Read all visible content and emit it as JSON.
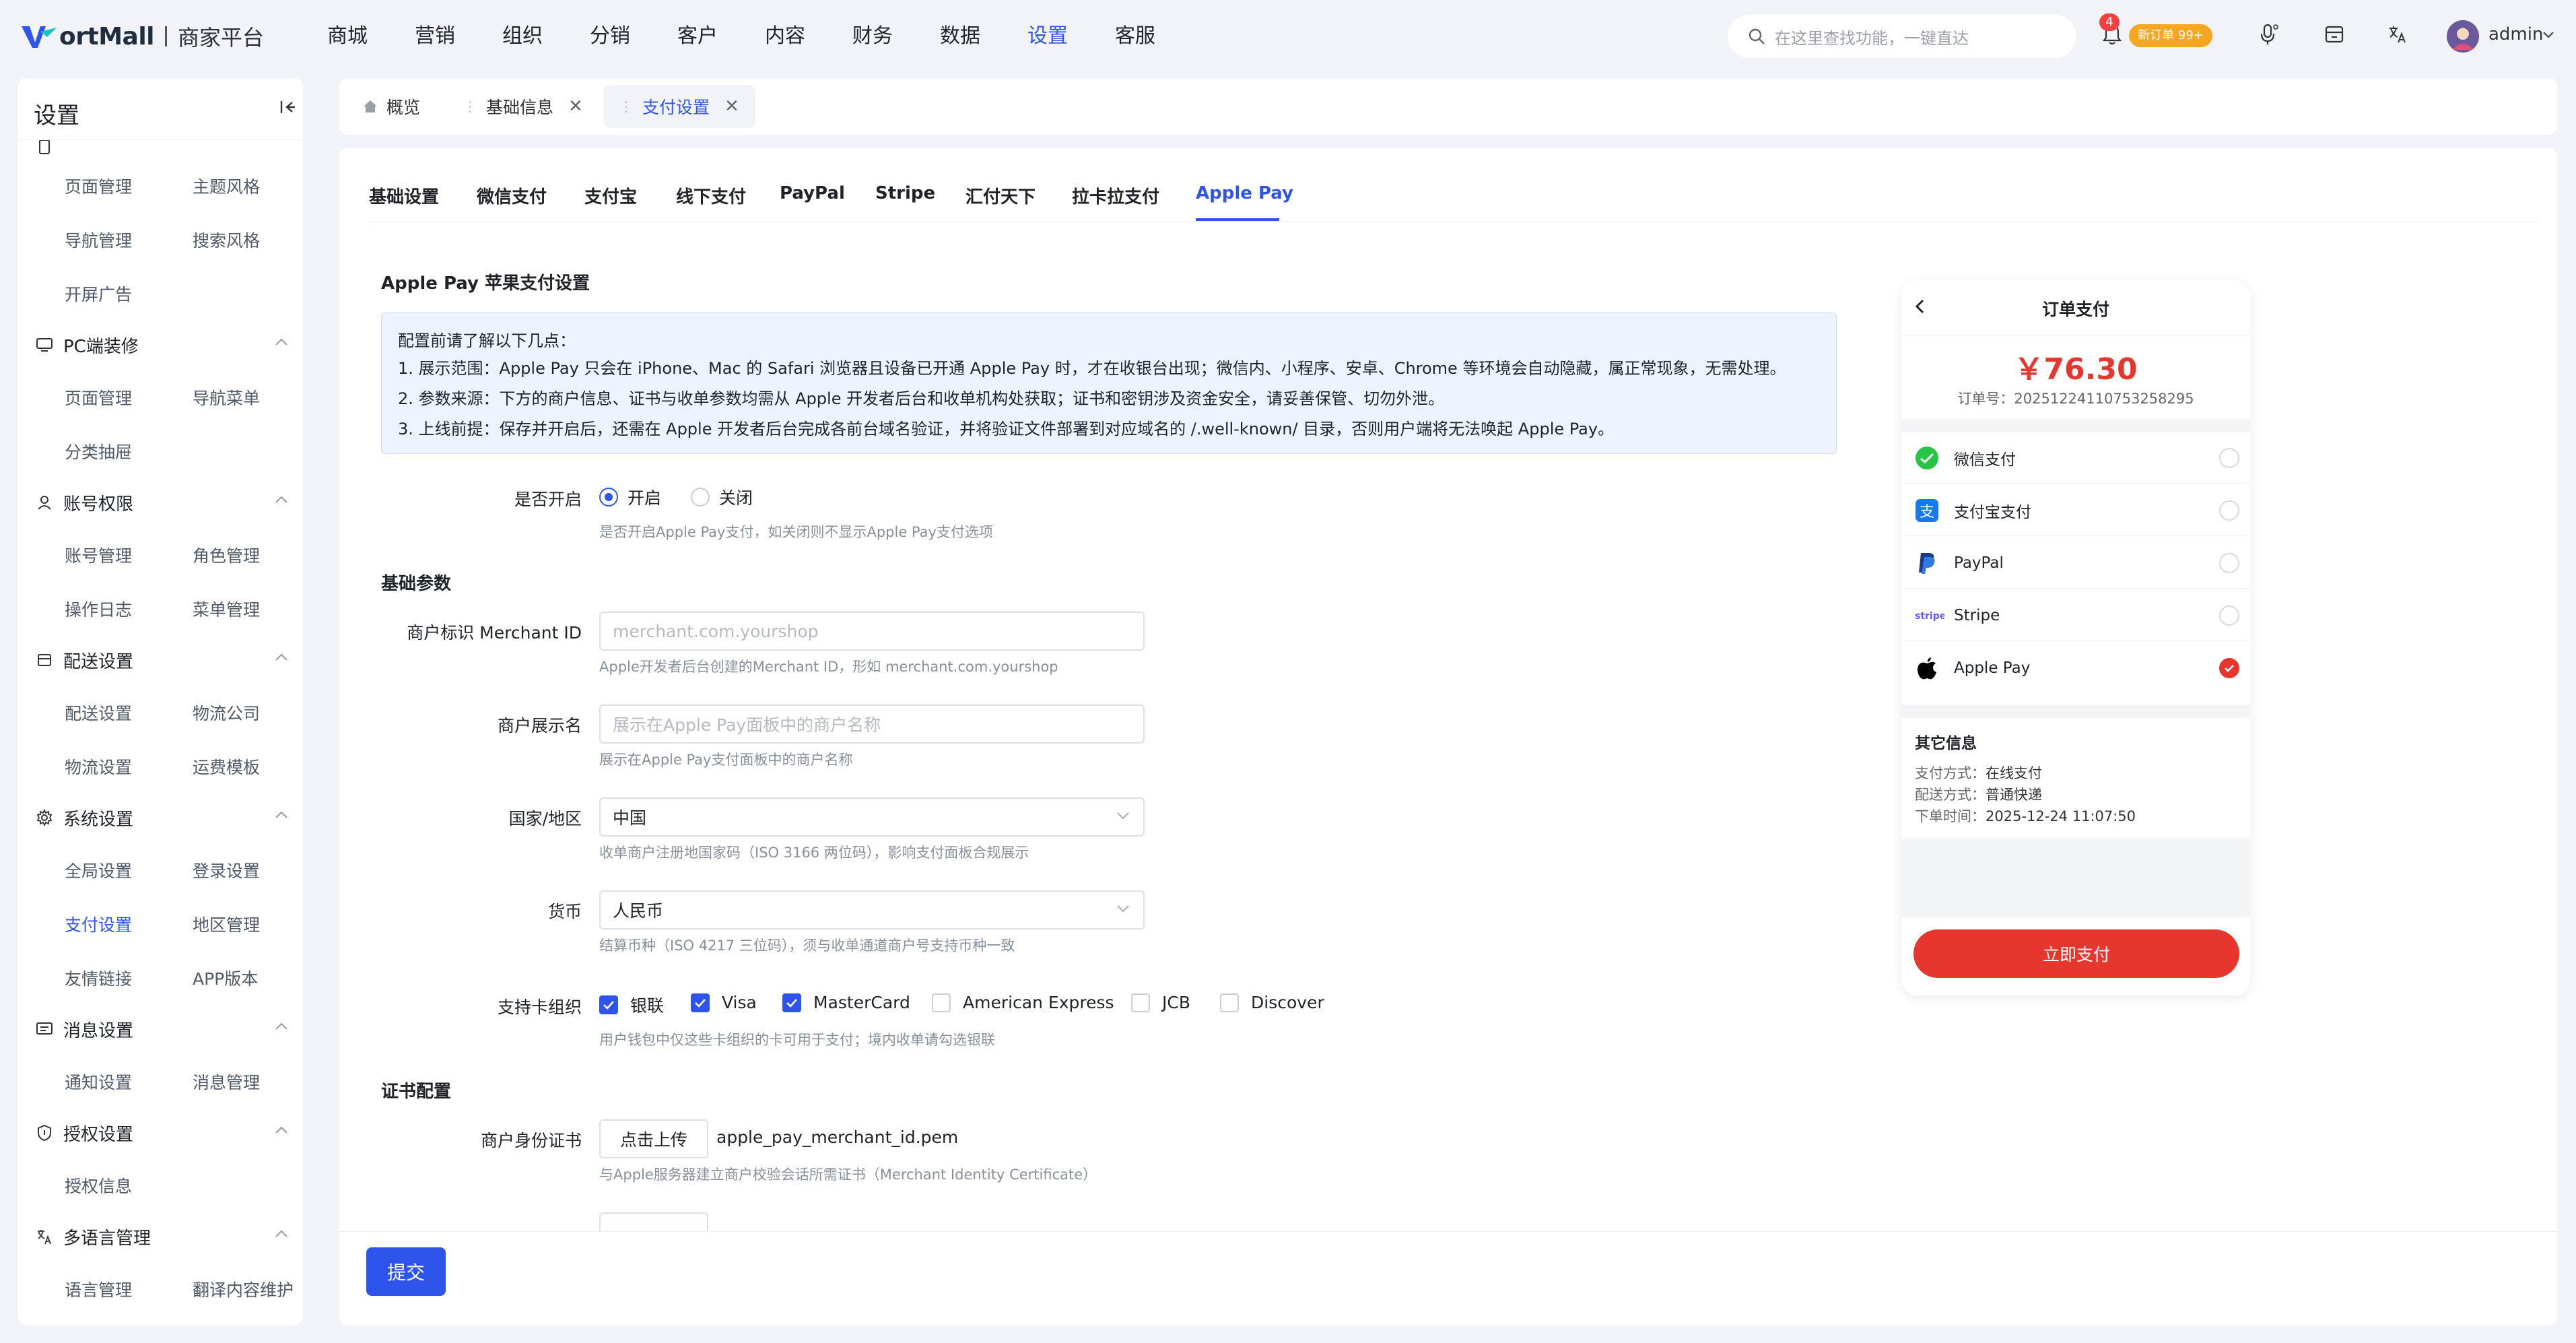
{
  "brand": {
    "logo_text": "ortMall",
    "sub": "商家平台"
  },
  "top_nav": [
    "商城",
    "营销",
    "组织",
    "分销",
    "客户",
    "内容",
    "财务",
    "数据",
    "设置",
    "客服"
  ],
  "top_nav_active": 8,
  "search": {
    "placeholder": "在这里查找功能，一键直达"
  },
  "notifications": {
    "count": "4",
    "order_badge": "新订单 99+"
  },
  "user": {
    "name": "admin"
  },
  "sidebar": {
    "title": "设置",
    "groups": [
      {
        "label": "",
        "icon": "mobile-icon",
        "items": [
          "页面管理",
          "主题风格",
          "导航管理",
          "搜索风格",
          "开屏广告"
        ]
      },
      {
        "label": "PC端装修",
        "icon": "monitor-icon",
        "items": [
          "页面管理",
          "导航菜单",
          "分类抽屉"
        ]
      },
      {
        "label": "账号权限",
        "icon": "user-icon",
        "items": [
          "账号管理",
          "角色管理",
          "操作日志",
          "菜单管理"
        ]
      },
      {
        "label": "配送设置",
        "icon": "box-icon",
        "items": [
          "配送设置",
          "物流公司",
          "物流设置",
          "运费模板"
        ]
      },
      {
        "label": "系统设置",
        "icon": "gear-icon",
        "items": [
          "全局设置",
          "登录设置",
          "支付设置",
          "地区管理",
          "友情链接",
          "APP版本"
        ]
      },
      {
        "label": "消息设置",
        "icon": "message-icon",
        "items": [
          "通知设置",
          "消息管理"
        ]
      },
      {
        "label": "授权设置",
        "icon": "shield-icon",
        "items": [
          "授权信息"
        ]
      },
      {
        "label": "多语言管理",
        "icon": "translate-icon",
        "items": [
          "语言管理",
          "翻译内容维护"
        ]
      }
    ]
  },
  "page_tabs": [
    {
      "label": "概览",
      "icon": "home-icon"
    },
    {
      "label": "基础信息",
      "closable": true
    },
    {
      "label": "支付设置",
      "closable": true,
      "active": true
    }
  ],
  "sub_tabs": [
    "基础设置",
    "微信支付",
    "支付宝",
    "线下支付",
    "PayPal",
    "Stripe",
    "汇付天下",
    "拉卡拉支付",
    "Apple Pay"
  ],
  "sub_tab_active": 8,
  "form": {
    "section_title": "Apple Pay 苹果支付设置",
    "notice": [
      "配置前请了解以下几点：",
      "1. 展示范围：Apple Pay 只会在 iPhone、Mac 的 Safari 浏览器且设备已开通 Apple Pay 时，才在收银台出现；微信内、小程序、安卓、Chrome 等环境会自动隐藏，属正常现象，无需处理。",
      "2. 参数来源：下方的商户信息、证书与收单参数均需从 Apple 开发者后台和收单机构处获取；证书和密钥涉及资金安全，请妥善保管、切勿外泄。",
      "3. 上线前提：保存并开启后，还需在 Apple 开发者后台完成各前台域名验证，并将验证文件部署到对应域名的 /.well-known/ 目录，否则用户端将无法唤起 Apple Pay。"
    ],
    "enable": {
      "label": "是否开启",
      "on": "开启",
      "off": "关闭",
      "hint": "是否开启Apple Pay支付，如关闭则不显示Apple Pay支付选项"
    },
    "basic_title": "基础参数",
    "merchant_id": {
      "label": "商户标识 Merchant ID",
      "placeholder": "merchant.com.yourshop",
      "hint": "Apple开发者后台创建的Merchant ID，形如 merchant.com.yourshop"
    },
    "merchant_name": {
      "label": "商户展示名",
      "placeholder": "展示在Apple Pay面板中的商户名称",
      "hint": "展示在Apple Pay支付面板中的商户名称"
    },
    "country": {
      "label": "国家/地区",
      "value": "中国",
      "hint": "收单商户注册地国家码（ISO 3166 两位码），影响支付面板合规展示"
    },
    "currency": {
      "label": "货币",
      "value": "人民币",
      "hint": "结算币种（ISO 4217 三位码），须与收单通道商户号支持币种一致"
    },
    "cards": {
      "label": "支持卡组织",
      "options": [
        {
          "name": "银联",
          "checked": true
        },
        {
          "name": "Visa",
          "checked": true
        },
        {
          "name": "MasterCard",
          "checked": true
        },
        {
          "name": "American Express",
          "checked": false
        },
        {
          "name": "JCB",
          "checked": false
        },
        {
          "name": "Discover",
          "checked": false
        }
      ],
      "hint": "用户钱包中仅这些卡组织的卡可用于支付；境内收单请勾选银联"
    },
    "cert_title": "证书配置",
    "identity_cert": {
      "label": "商户身份证书",
      "button": "点击上传",
      "file": "apple_pay_merchant_id.pem",
      "hint": "与Apple服务器建立商户校验会话所需证书（Merchant Identity Certificate）"
    },
    "submit": "提交"
  },
  "preview": {
    "title": "订单支付",
    "amount": "￥76.30",
    "order_no": "订单号：20251224110753258295",
    "methods": [
      {
        "name": "微信支付",
        "icon": "wechat-icon",
        "selected": false
      },
      {
        "name": "支付宝支付",
        "icon": "alipay-icon",
        "selected": false
      },
      {
        "name": "PayPal",
        "icon": "paypal-icon",
        "selected": false
      },
      {
        "name": "Stripe",
        "icon": "stripe-icon",
        "selected": false
      },
      {
        "name": "Apple Pay",
        "icon": "apple-icon",
        "selected": true
      }
    ],
    "other": {
      "title": "其它信息",
      "rows": [
        {
          "k": "支付方式：",
          "v": "在线支付"
        },
        {
          "k": "配送方式：",
          "v": "普通快递"
        },
        {
          "k": "下单时间：",
          "v": "2025-12-24 11:07:50"
        }
      ]
    },
    "pay_button": "立即支付"
  },
  "colors": {
    "accent": "#2f54eb",
    "pay_red": "#e6362d",
    "badge_orange": "#f5a623"
  }
}
